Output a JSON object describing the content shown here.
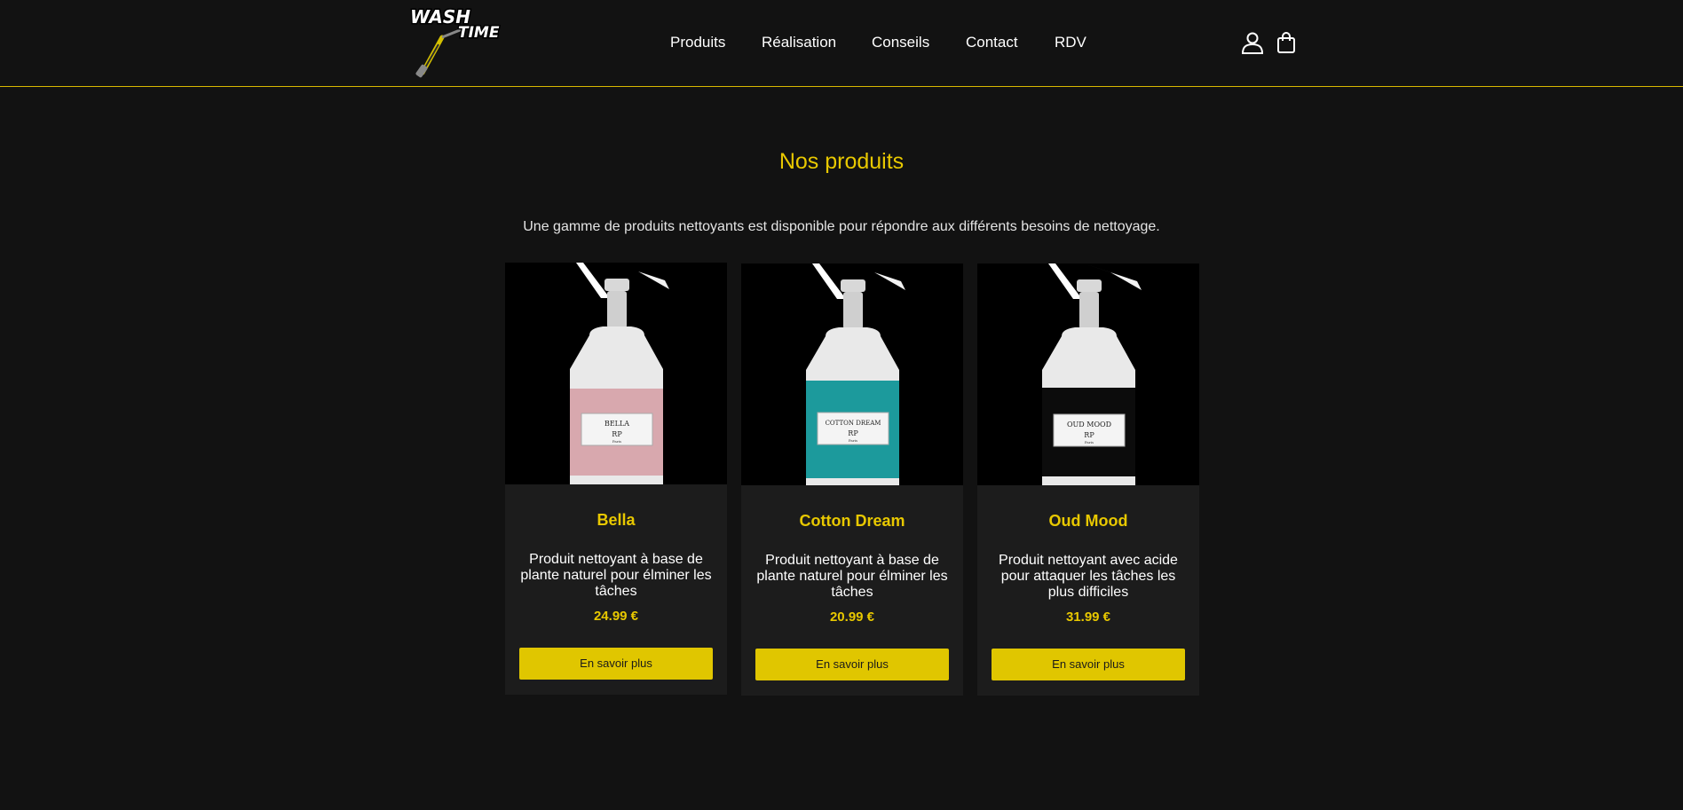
{
  "brand": {
    "logo_line1": "WASH",
    "logo_line2": "TIME"
  },
  "nav": {
    "items": [
      {
        "label": "Produits"
      },
      {
        "label": "Réalisation"
      },
      {
        "label": "Conseils"
      },
      {
        "label": "Contact"
      },
      {
        "label": "RDV"
      }
    ]
  },
  "header_icons": [
    "user-icon",
    "shopping-bag-icon"
  ],
  "main": {
    "title": "Nos produits",
    "subtitle": "Une gamme de produits nettoyants est disponible pour répondre aux différents besoins de nettoyage."
  },
  "colors": {
    "accent": "#e8c800",
    "background": "#121212",
    "card": "#1c1c1c",
    "button": "#e0c600"
  },
  "products": [
    {
      "name": "Bella",
      "label_text": "BELLA",
      "label_brand": "RP",
      "label_city": "Paris",
      "description": "Produit nettoyant à base de plante naturel pour élminer les tâches",
      "price": "24.99 €",
      "button": "En savoir plus",
      "bottle_color": "#d8a8ae"
    },
    {
      "name": "Cotton Dream",
      "label_text": "COTTON DREAM",
      "label_brand": "RP",
      "label_city": "Paris",
      "description": "Produit nettoyant à base de plante naturel pour élminer les tâches",
      "price": "20.99 €",
      "button": "En savoir plus",
      "bottle_color": "#1c9a9c"
    },
    {
      "name": "Oud Mood",
      "label_text": "OUD MOOD",
      "label_brand": "RP",
      "label_city": "Paris",
      "description": "Produit nettoyant avec acide pour attaquer les tâches les plus difficiles",
      "price": "31.99 €",
      "button": "En savoir plus",
      "bottle_color": "#0c0c0c"
    }
  ]
}
